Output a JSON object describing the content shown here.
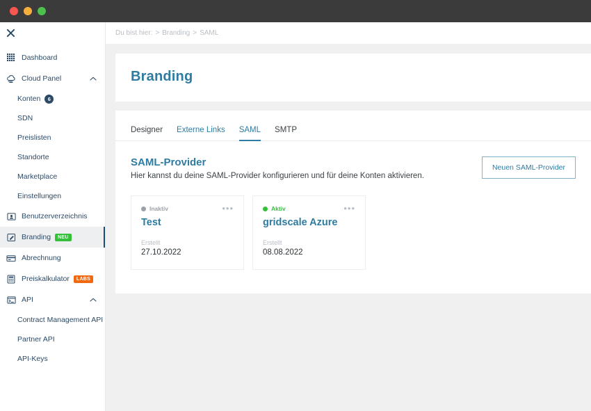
{
  "titlebar": {
    "buttons": [
      "close",
      "minimize",
      "zoom"
    ]
  },
  "sidebar": {
    "close_icon": "close-icon",
    "items": [
      {
        "label": "Dashboard",
        "icon": "grid-icon",
        "type": "item"
      },
      {
        "label": "Cloud Panel",
        "icon": "cloud-icon",
        "type": "group",
        "expanded": true,
        "chevron": "chevron-up-icon"
      },
      {
        "label": "Konten",
        "type": "sub",
        "badge": "6"
      },
      {
        "label": "SDN",
        "type": "sub"
      },
      {
        "label": "Preislisten",
        "type": "sub"
      },
      {
        "label": "Standorte",
        "type": "sub"
      },
      {
        "label": "Marketplace",
        "type": "sub"
      },
      {
        "label": "Einstellungen",
        "type": "sub"
      },
      {
        "label": "Benutzerverzeichnis",
        "icon": "user-card-icon",
        "type": "item"
      },
      {
        "label": "Branding",
        "icon": "pencil-square-icon",
        "type": "item",
        "tag": "NEU",
        "tag_style": "neu",
        "active": true
      },
      {
        "label": "Abrechnung",
        "icon": "credit-card-icon",
        "type": "item"
      },
      {
        "label": "Preiskalkulator",
        "icon": "calculator-icon",
        "type": "item",
        "tag": "LABS",
        "tag_style": "labs"
      },
      {
        "label": "API",
        "icon": "terminal-icon",
        "type": "group",
        "expanded": true,
        "chevron": "chevron-up-icon"
      },
      {
        "label": "Contract Management API",
        "type": "sub"
      },
      {
        "label": "Partner API",
        "type": "sub"
      },
      {
        "label": "API-Keys",
        "type": "sub"
      }
    ]
  },
  "breadcrumb": {
    "prefix": "Du bist hier:",
    "items": [
      "Branding",
      "SAML"
    ],
    "separator": ">"
  },
  "page": {
    "title": "Branding"
  },
  "tabs": [
    {
      "label": "Designer",
      "state": "default"
    },
    {
      "label": "Externe Links",
      "state": "link"
    },
    {
      "label": "SAML",
      "state": "active"
    },
    {
      "label": "SMTP",
      "state": "default"
    }
  ],
  "section": {
    "title": "SAML-Provider",
    "description": "Hier kannst du deine SAML-Provider konfigurieren und für deine Konten aktivieren.",
    "action_button": "Neuen SAML-Provider"
  },
  "cards": [
    {
      "status": "Inaktiv",
      "status_state": "inactive",
      "title": "Test",
      "meta_label": "Erstellt",
      "meta_value": "27.10.2022",
      "menu_icon": "kebab-menu-icon"
    },
    {
      "status": "Aktiv",
      "status_state": "active",
      "title": "gridscale Azure",
      "meta_label": "Erstellt",
      "meta_value": "08.08.2022",
      "menu_icon": "kebab-menu-icon"
    }
  ],
  "colors": {
    "brand_blue": "#2e7ca1",
    "navy": "#2c4a66",
    "green": "#35c03c",
    "orange": "#f2680f",
    "muted": "#b9bec4",
    "titlebar": "#3b3b3b"
  }
}
